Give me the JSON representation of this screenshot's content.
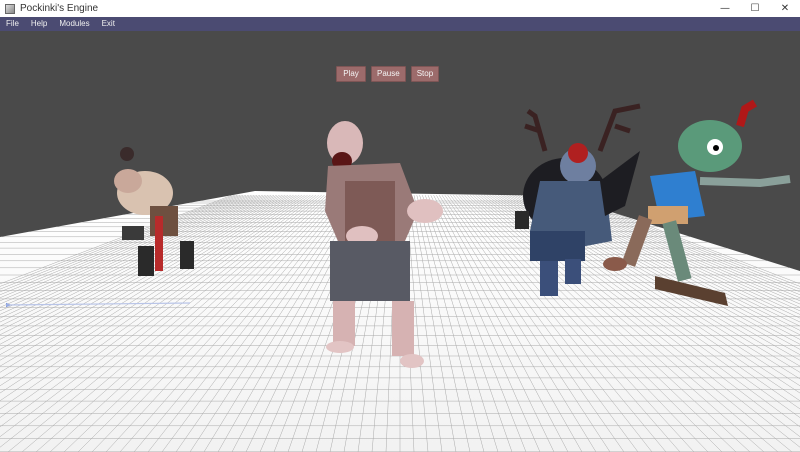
{
  "window": {
    "title": "Pockinki's Engine",
    "controls": {
      "minimize": "—",
      "maximize": "☐",
      "close": "✕"
    }
  },
  "menu": {
    "items": [
      "File",
      "Help",
      "Modules",
      "Exit"
    ]
  },
  "playback": {
    "play": "Play",
    "pause": "Pause",
    "stop": "Stop"
  },
  "scene": {
    "background_color": "#4a4a4a",
    "floor_color": "#ffffff",
    "grid_color": "#9a9a9a",
    "characters": [
      "hunchback-zombie",
      "screaming-zombie",
      "antlered-zombie",
      "skater-zombie"
    ]
  }
}
